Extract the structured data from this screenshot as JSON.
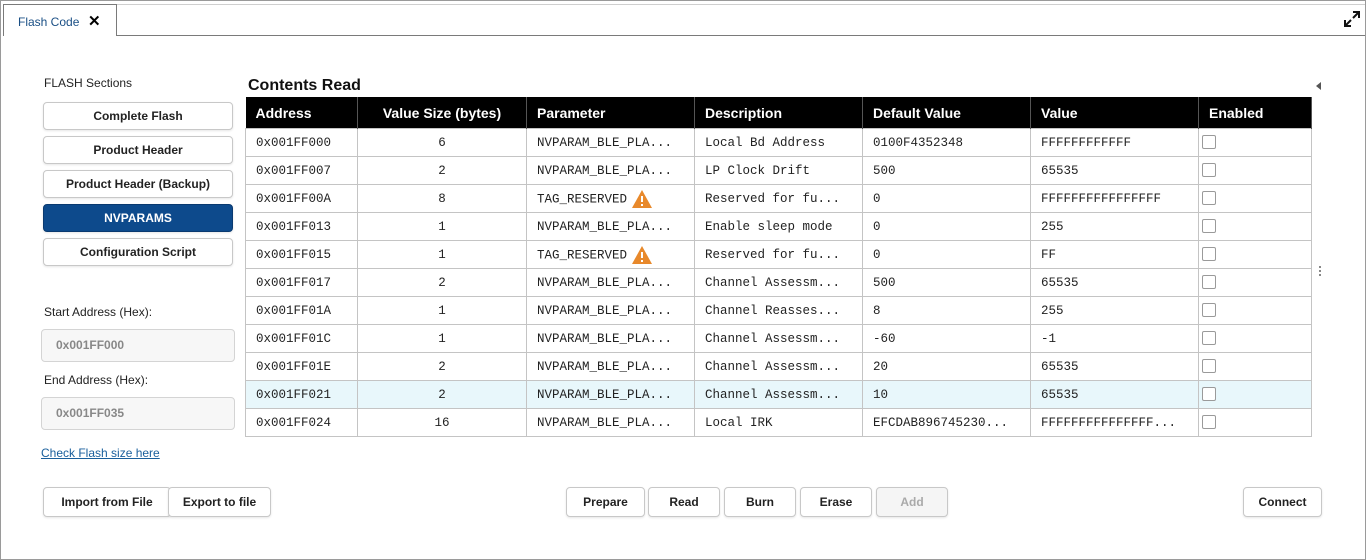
{
  "tabs": [
    {
      "label": "Flash Code"
    }
  ],
  "sidebar": {
    "title": "FLASH Sections",
    "sections": [
      "Complete Flash",
      "Product Header",
      "Product Header (Backup)",
      "NVPARAMS",
      "Configuration Script"
    ],
    "active_section": "NVPARAMS",
    "start_label": "Start Address (Hex):",
    "start_value": "0x001FF000",
    "end_label": "End Address (Hex):",
    "end_value": "0x001FF035",
    "check_link": "Check Flash size here"
  },
  "contents": {
    "title": "Contents Read",
    "columns": [
      "Address",
      "Value Size (bytes)",
      "Parameter",
      "Description",
      "Default Value",
      "Value",
      "Enabled"
    ],
    "rows": [
      {
        "address": "0x001FF000",
        "size": "6",
        "parameter": "NVPARAM_BLE_PLA...",
        "description": "Local Bd Address",
        "default": "0100F4352348",
        "value": "FFFFFFFFFFFF",
        "warn": false
      },
      {
        "address": "0x001FF007",
        "size": "2",
        "parameter": "NVPARAM_BLE_PLA...",
        "description": "LP Clock Drift",
        "default": "500",
        "value": "65535",
        "warn": false
      },
      {
        "address": "0x001FF00A",
        "size": "8",
        "parameter": "TAG_RESERVED",
        "description": "Reserved for fu...",
        "default": "0",
        "value": "FFFFFFFFFFFFFFFF",
        "warn": true
      },
      {
        "address": "0x001FF013",
        "size": "1",
        "parameter": "NVPARAM_BLE_PLA...",
        "description": "Enable sleep mode",
        "default": "0",
        "value": "255",
        "warn": false
      },
      {
        "address": "0x001FF015",
        "size": "1",
        "parameter": "TAG_RESERVED",
        "description": "Reserved for fu...",
        "default": "0",
        "value": "FF",
        "warn": true
      },
      {
        "address": "0x001FF017",
        "size": "2",
        "parameter": "NVPARAM_BLE_PLA...",
        "description": "Channel Assessm...",
        "default": "500",
        "value": "65535",
        "warn": false
      },
      {
        "address": "0x001FF01A",
        "size": "1",
        "parameter": "NVPARAM_BLE_PLA...",
        "description": "Channel Reasses...",
        "default": "8",
        "value": "255",
        "warn": false
      },
      {
        "address": "0x001FF01C",
        "size": "1",
        "parameter": "NVPARAM_BLE_PLA...",
        "description": "Channel Assessm...",
        "default": "-60",
        "value": "-1",
        "warn": false
      },
      {
        "address": "0x001FF01E",
        "size": "2",
        "parameter": "NVPARAM_BLE_PLA...",
        "description": "Channel Assessm...",
        "default": "20",
        "value": "65535",
        "warn": false
      },
      {
        "address": "0x001FF021",
        "size": "2",
        "parameter": "NVPARAM_BLE_PLA...",
        "description": "Channel Assessm...",
        "default": "10",
        "value": "65535",
        "warn": false,
        "selected": true
      },
      {
        "address": "0x001FF024",
        "size": "16",
        "parameter": "NVPARAM_BLE_PLA...",
        "description": "Local IRK",
        "default": "EFCDAB896745230...",
        "value": "FFFFFFFFFFFFFFF...",
        "warn": false
      }
    ]
  },
  "buttons": {
    "import": "Import from File",
    "export": "Export to file",
    "prepare": "Prepare",
    "read": "Read",
    "burn": "Burn",
    "erase": "Erase",
    "add": "Add",
    "connect": "Connect"
  },
  "colors": {
    "active": "#0d4a8c",
    "warning": "#e8892b",
    "selected_row": "#e8f7fb",
    "header_bg": "#000000"
  }
}
